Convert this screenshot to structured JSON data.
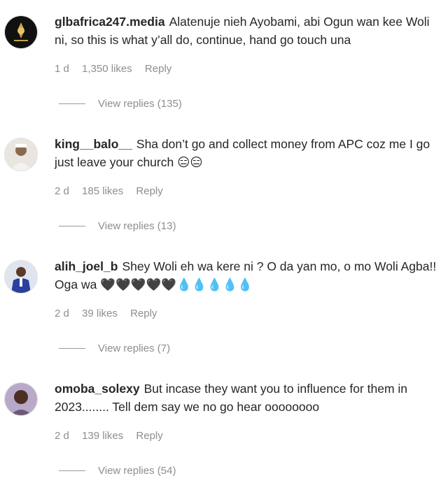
{
  "comments": [
    {
      "username": "glbafrica247.media",
      "text": "Alatenuje nieh Ayobami, abi Ogun wan kee Woli ni, so this is what y’all do, continue, hand go touch una",
      "time": "1 d",
      "likes": "1,350 likes",
      "reply_label": "Reply",
      "view_replies": "View replies (135)",
      "avatar_icon": "brand-logo-avatar"
    },
    {
      "username": "king__balo__",
      "text": "Sha don’t go and collect money from APC coz me I go just leave your church 😑😑",
      "time": "2 d",
      "likes": "185 likes",
      "reply_label": "Reply",
      "view_replies": "View replies (13)",
      "avatar_icon": "user-photo-avatar"
    },
    {
      "username": "alih_joel_b",
      "text": "Shey Woli eh wa kere ni ? O da yan mo, o mo Woli Agba!! Oga wa 🖤🖤🖤🖤🖤💧💧💧💧💧",
      "time": "2 d",
      "likes": "39 likes",
      "reply_label": "Reply",
      "view_replies": "View replies (7)",
      "avatar_icon": "user-photo-avatar"
    },
    {
      "username": "omoba_solexy",
      "text": "But incase they want you to influence for them in 2023........ Tell dem say we no go hear oooooooo",
      "time": "2 d",
      "likes": "139 likes",
      "reply_label": "Reply",
      "view_replies": "View replies (54)",
      "avatar_icon": "user-photo-avatar"
    }
  ],
  "colors": {
    "text": "#262626",
    "meta": "#8e8e8e"
  }
}
